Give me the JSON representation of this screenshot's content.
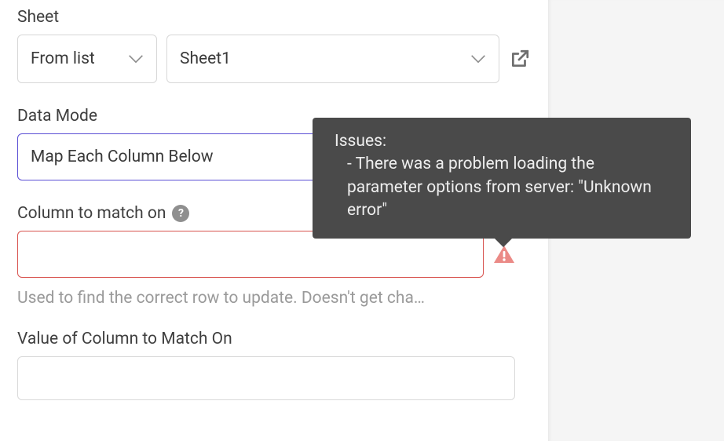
{
  "sheet": {
    "label": "Sheet",
    "mode_value": "From list",
    "name_value": "Sheet1"
  },
  "data_mode": {
    "label": "Data Mode",
    "value": "Map Each Column Below"
  },
  "column_match": {
    "label": "Column to match on",
    "value": "",
    "hint": "Used to find the correct row to update. Doesn't get cha…"
  },
  "value_match": {
    "label": "Value of Column to Match On",
    "value": ""
  },
  "tooltip": {
    "title": "Issues:",
    "body": "- There was a problem loading the parameter options from server: \"Unknown error\""
  }
}
